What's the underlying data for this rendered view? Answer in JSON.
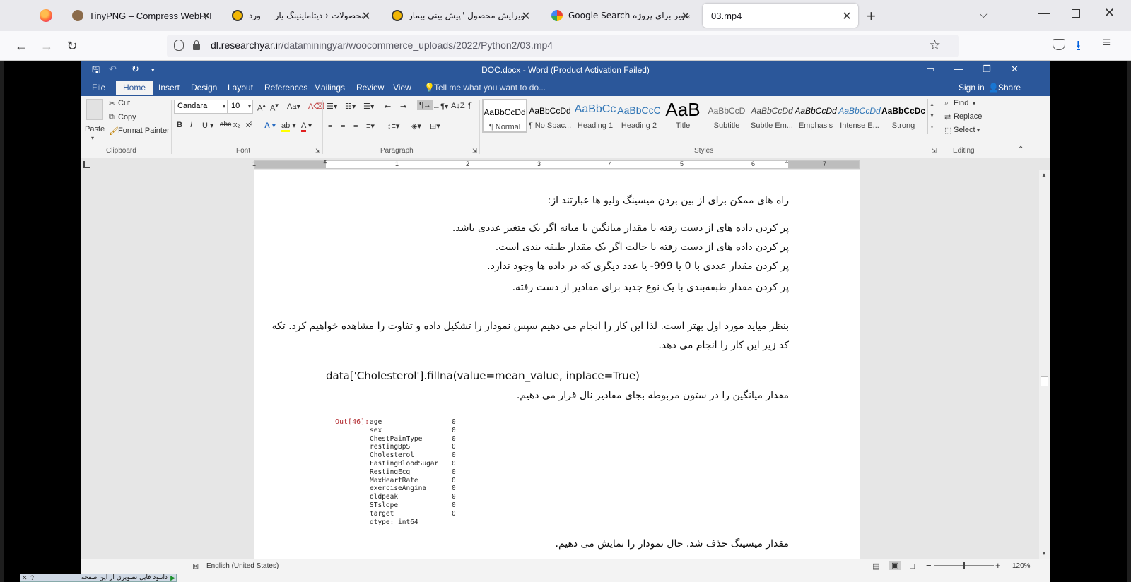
{
  "browser": {
    "tabs": [
      {
        "title": "TinyPNG – Compress WebP, PNG",
        "active": false
      },
      {
        "title": "محصولات ‹ دیتاماینینگ یار — ورد",
        "active": false
      },
      {
        "title": "ویرایش محصول \"پیش بینی بیمار",
        "active": false
      },
      {
        "title": "Google Search تصویر برای پروژه",
        "active": false
      },
      {
        "title": "03.mp4",
        "active": true
      }
    ],
    "url_domain": "dl.researchyar.ir",
    "url_path": "/dataminingyar/woocommerce_uploads/2022/Python2/03.mp4",
    "new_tab_symbol": "+"
  },
  "word": {
    "title": "DOC.docx - Word (Product Activation Failed)",
    "menus": [
      "File",
      "Home",
      "Insert",
      "Design",
      "Layout",
      "References",
      "Mailings",
      "Review",
      "View"
    ],
    "tell_me": "Tell me what you want to do...",
    "sign_in": "Sign in",
    "share": "Share",
    "clipboard": {
      "paste": "Paste",
      "cut": "Cut",
      "copy": "Copy",
      "format_painter": "Format Painter",
      "label": "Clipboard"
    },
    "font": {
      "name": "Candara",
      "size": "10",
      "label": "Font"
    },
    "paragraph_label": "Paragraph",
    "styles": [
      {
        "sample": "AaBbCcDd",
        "name": "¶ Normal"
      },
      {
        "sample": "AaBbCcDd",
        "name": "¶ No Spac..."
      },
      {
        "sample": "AaBbCc",
        "name": "Heading 1"
      },
      {
        "sample": "AaBbCcC",
        "name": "Heading 2"
      },
      {
        "sample": "AaB",
        "name": "Title"
      },
      {
        "sample": "AaBbCcD",
        "name": "Subtitle"
      },
      {
        "sample": "AaBbCcDd",
        "name": "Subtle Em..."
      },
      {
        "sample": "AaBbCcDd",
        "name": "Emphasis"
      },
      {
        "sample": "AaBbCcDd",
        "name": "Intense E..."
      },
      {
        "sample": "AaBbCcDc",
        "name": "Strong"
      }
    ],
    "styles_label": "Styles",
    "editing": {
      "find": "Find",
      "replace": "Replace",
      "select": "Select",
      "label": "Editing"
    },
    "ruler_numbers": [
      "1",
      "1",
      "2",
      "3",
      "4",
      "5",
      "6",
      "7"
    ],
    "document": {
      "line1": "راه های ممکن برای از بین بردن میسینگ ولیو ها عبارتند از:",
      "bullets": [
        "پر کردن داده های از دست رفته با مقدار میانگین یا میانه اگر یک متغیر عددی باشد.",
        "پر کردن داده های از دست رفته با حالت اگر یک مقدار طبقه بندی است.",
        "پر کردن مقدار عددی با 0 یا 999- یا عدد دیگری که در داده ها وجود ندارد.",
        "پر کردن مقدار طبقه‌بندی با یک نوع جدید برای مقادیر از دست رفته."
      ],
      "para1_line1": "بنظر میاید مورد اول بهتر است. لذا این کار را انجام می دهیم سپس نمودار را تشکیل داده و تفاوت را مشاهده خواهیم کرد. تکه",
      "para1_line2": "کد زیر این کار را انجام می دهد.",
      "code": "data['Cholesterol'].fillna(value=mean_value, inplace=True)",
      "para2": "مقدار میانگین را در ستون مربوطه بجای مقادیر نال قرار می دهیم.",
      "out_label": "Out[46]:",
      "output_rows": [
        {
          "name": "age",
          "value": "0"
        },
        {
          "name": "sex",
          "value": "0"
        },
        {
          "name": "ChestPainType",
          "value": "0"
        },
        {
          "name": "restingBpS",
          "value": "0"
        },
        {
          "name": "Cholesterol",
          "value": "0"
        },
        {
          "name": "FastingBloodSugar",
          "value": "0"
        },
        {
          "name": "RestingEcg",
          "value": "0"
        },
        {
          "name": "MaxHeartRate",
          "value": "0"
        },
        {
          "name": "exerciseAngina",
          "value": "0"
        },
        {
          "name": "oldpeak",
          "value": "0"
        },
        {
          "name": "STslope",
          "value": "0"
        },
        {
          "name": "target",
          "value": "0"
        }
      ],
      "dtype": "dtype: int64",
      "para3": "مقدار میسینگ حذف شد. حال نمودار را نمایش می دهیم."
    },
    "status": {
      "language": "English (United States)",
      "zoom": "120%"
    }
  },
  "download_bar": {
    "text": "دانلود فایل تصویری از این صفحه"
  },
  "colors": {
    "word_blue": "#2b579a",
    "ribbon_bg": "#f3f3f3",
    "out_red": "#b22b31"
  }
}
